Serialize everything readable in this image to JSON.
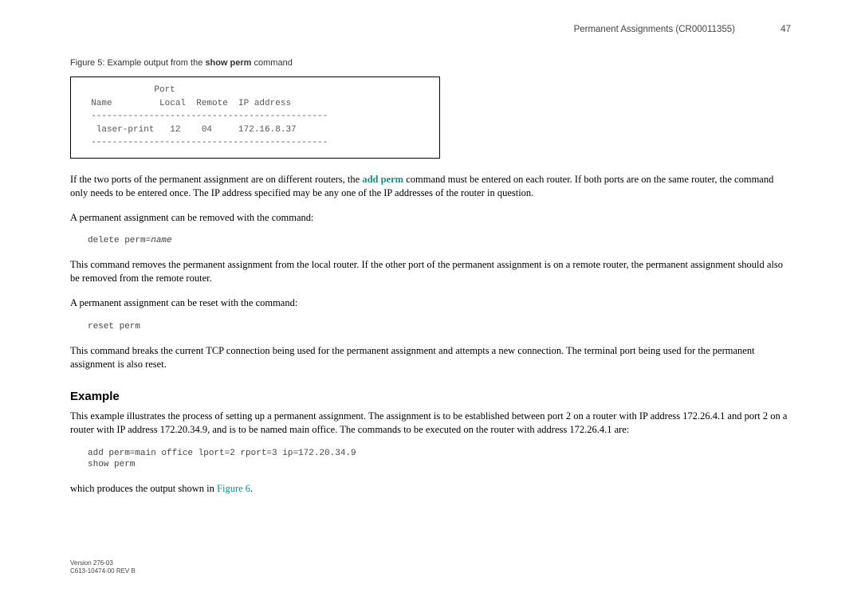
{
  "header": {
    "title": "Permanent Assignments (CR00011355)",
    "page_number": "47"
  },
  "figure": {
    "caption_prefix": "Figure 5: Example output from the ",
    "caption_bold": "show perm",
    "caption_suffix": " command",
    "output": "              Port\n  Name         Local  Remote  IP address\n  ---------------------------------------------\n   laser-print   12    04     172.16.8.37\n  ---------------------------------------------"
  },
  "paragraphs": {
    "p1_a": "If the two ports of the permanent assignment are on different routers, the ",
    "p1_link": "add perm",
    "p1_b": " command must be entered on each router. If both ports are on the same router, the command only needs to be entered once. The IP address specified may be any one of the IP addresses of the router in question.",
    "p2": "A permanent assignment can be removed with the command:",
    "code1_a": "delete perm=",
    "code1_b": "name",
    "p3": "This command removes the permanent assignment from the local router. If the other port of the permanent assignment is on a remote router, the permanent assignment should also be removed from the remote router.",
    "p4": "A permanent assignment can be reset with the command:",
    "code2": "reset perm",
    "p5": "This command breaks the current TCP connection being used for the permanent assignment and attempts a new connection. The terminal port being used for the permanent assignment is also reset."
  },
  "example": {
    "heading": "Example",
    "p1": "This example illustrates the process of setting up a permanent assignment. The assignment is to be established between port 2 on a router with IP address 172.26.4.1 and port 2 on a router with IP address 172.20.34.9, and is to be named main office. The commands to be executed on the router with address 172.26.4.1 are:",
    "code": "add perm=main office lport=2 rport=3 ip=172.20.34.9\nshow perm",
    "p2_a": "which produces the output shown in ",
    "p2_link": "Figure 6",
    "p2_b": "."
  },
  "footer": {
    "line1": "Version 276-03",
    "line2": "C613-10474-00 REV B"
  }
}
